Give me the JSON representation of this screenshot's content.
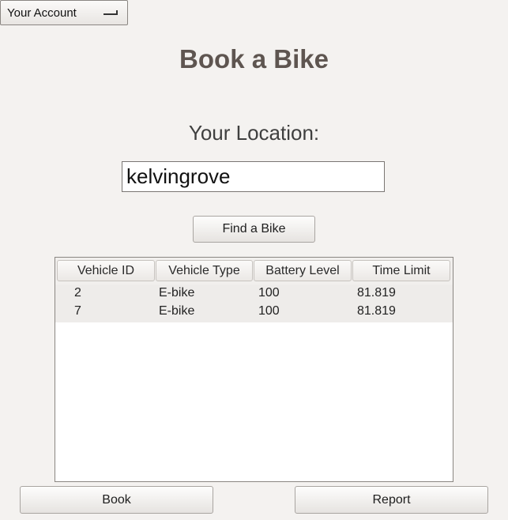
{
  "account_menu": {
    "label": "Your Account"
  },
  "page_title": "Book a Bike",
  "location": {
    "label": "Your Location:",
    "value": "kelvingrove"
  },
  "find_button": "Find a Bike",
  "table": {
    "columns": [
      "Vehicle ID",
      "Vehicle Type",
      "Battery Level",
      "Time Limit"
    ],
    "rows": [
      [
        "2",
        "E-bike",
        "100",
        "81.819"
      ],
      [
        "7",
        "E-bike",
        "100",
        "81.819"
      ]
    ]
  },
  "actions": {
    "book": "Book",
    "report": "Report"
  }
}
